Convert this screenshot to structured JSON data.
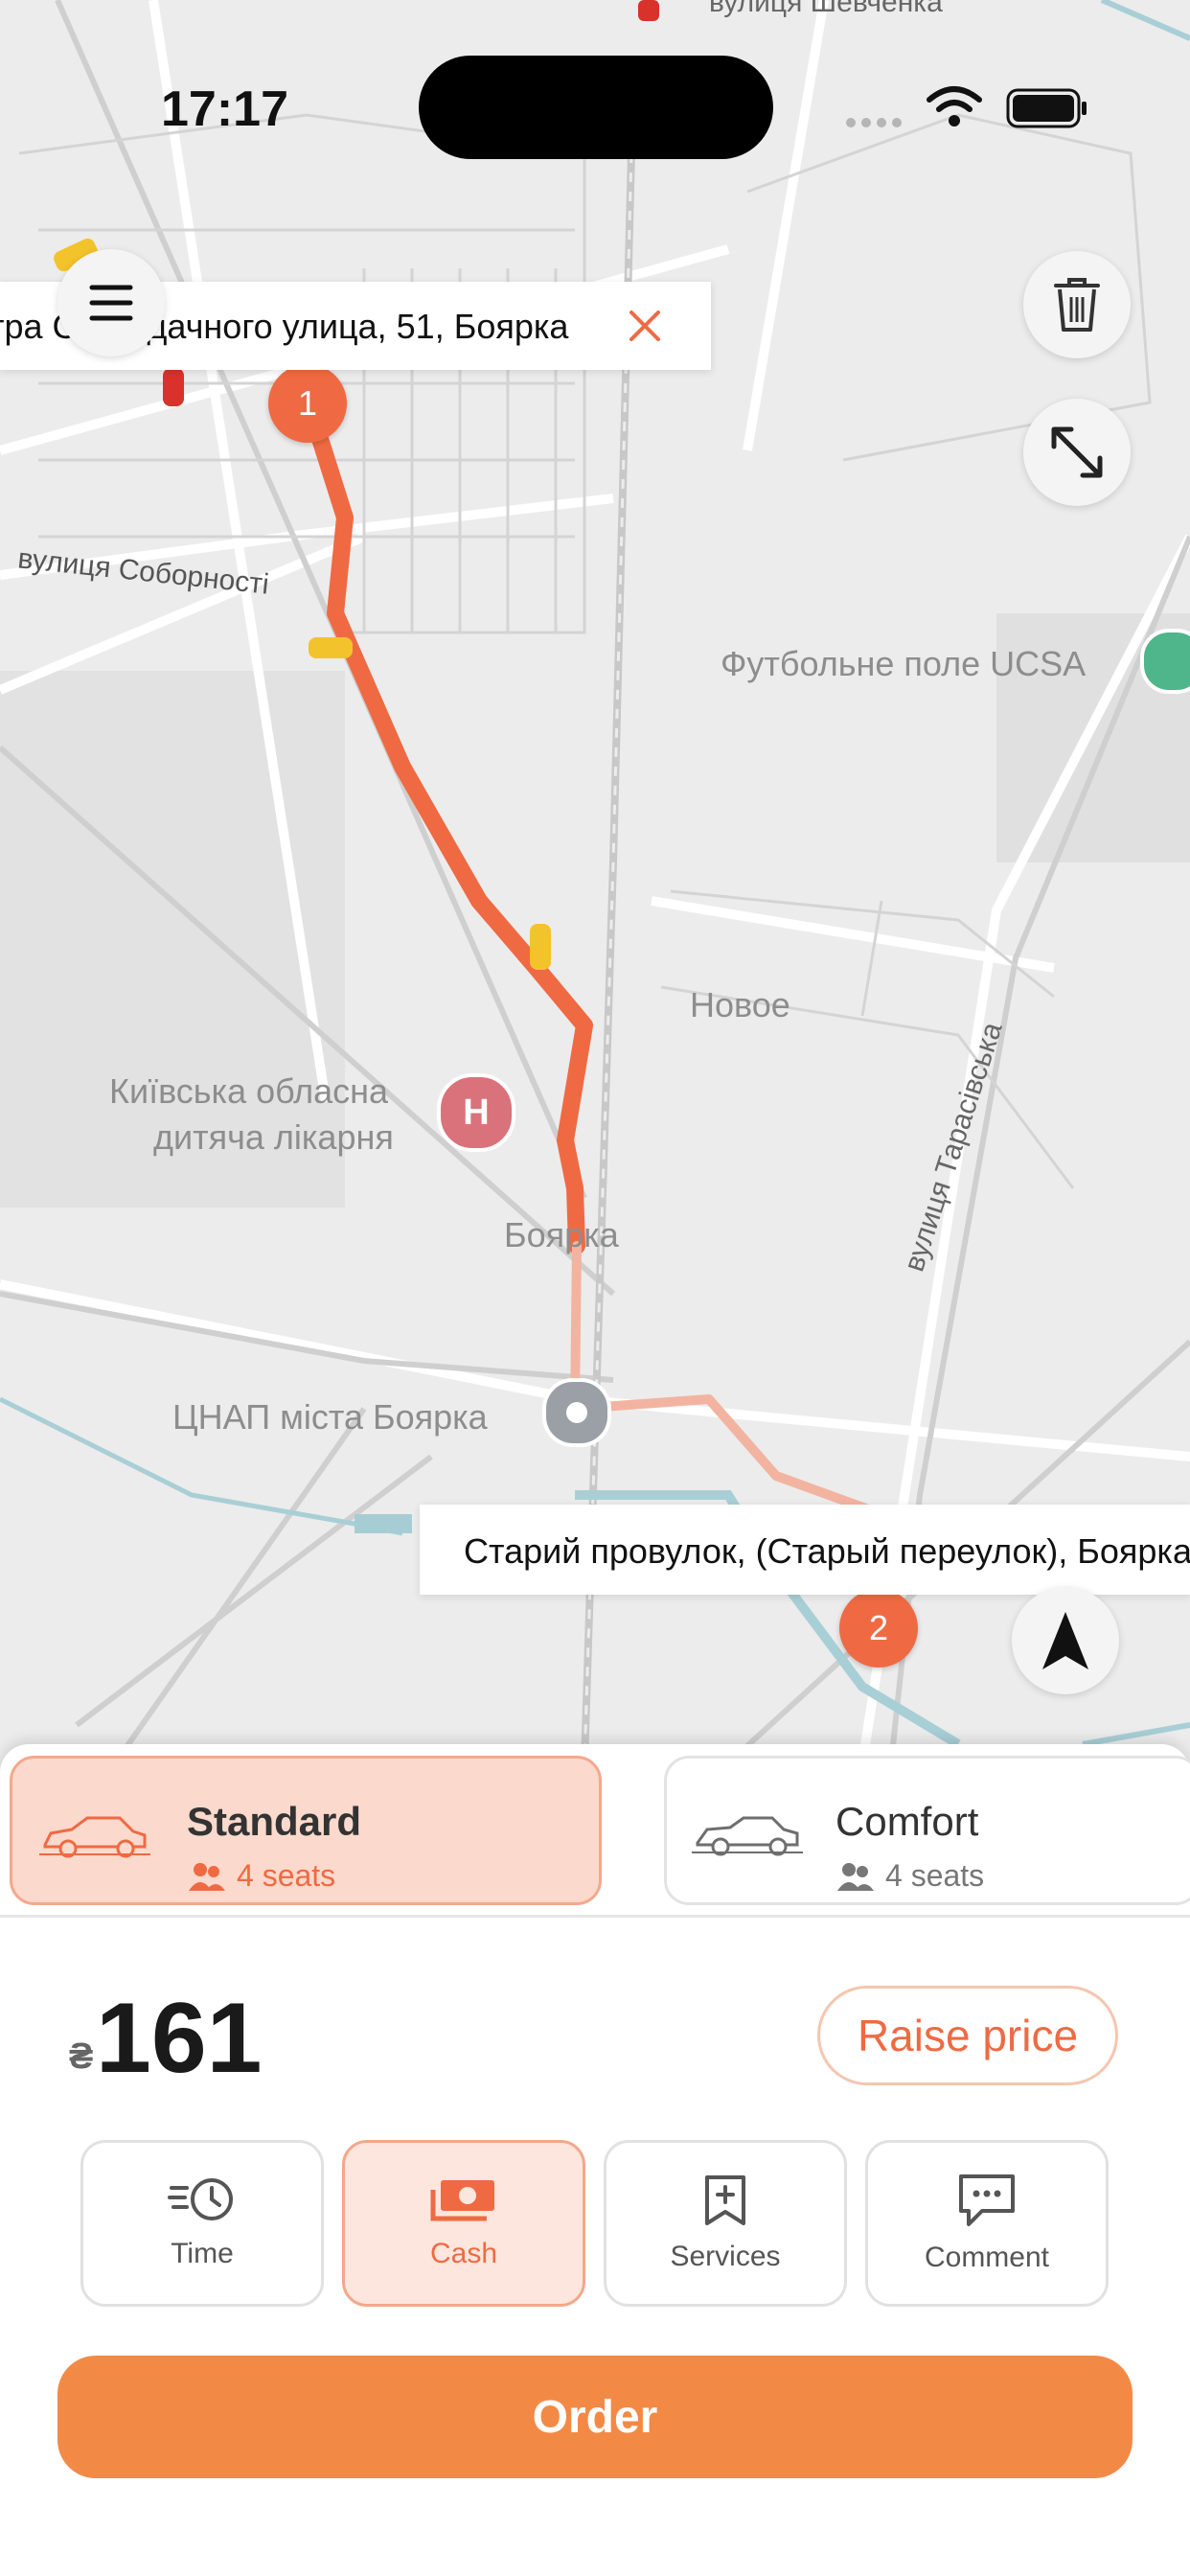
{
  "status_bar": {
    "time": "17:17"
  },
  "map": {
    "labels": {
      "street_top": "вулиця Шевченка",
      "street_sobornosti": "вулиця Соборності",
      "football": "Футбольне поле UCSA",
      "novoe": "Новое",
      "hospital_line1": "Київська обласна",
      "hospital_line2": "дитяча лікарня",
      "boyarka": "Боярка",
      "tsnap": "ЦНАП міста Боярка",
      "tarasivska": "вулиця Тарасівська"
    },
    "hospital_marker": "H"
  },
  "route": {
    "from_address": "тра Сагайдачного улица, 51, Боярка",
    "to_address": "Старий провулок, (Старый переулок), Боярка",
    "from_pin": "1",
    "to_pin": "2",
    "color": "#ef6a43"
  },
  "classes": [
    {
      "name": "Standard",
      "seats": "4 seats",
      "selected": true
    },
    {
      "name": "Comfort",
      "seats": "4 seats",
      "selected": false
    }
  ],
  "price": {
    "currency": "₴",
    "amount": "161",
    "raise_label": "Raise price"
  },
  "options": [
    {
      "label": "Time",
      "icon": "clock-icon",
      "active": false
    },
    {
      "label": "Cash",
      "icon": "cash-icon",
      "active": true
    },
    {
      "label": "Services",
      "icon": "bookmark-plus-icon",
      "active": false
    },
    {
      "label": "Comment",
      "icon": "comment-icon",
      "active": false
    }
  ],
  "order_label": "Order",
  "colors": {
    "accent": "#ef6a43",
    "order_button": "#f28a46",
    "selected_bg": "#fde6dd"
  }
}
